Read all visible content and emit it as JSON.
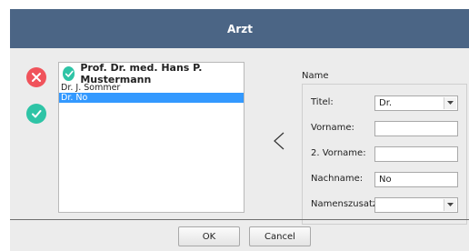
{
  "window": {
    "title": "Arzt"
  },
  "actions": {
    "delete_icon": "close-circle-icon",
    "confirm_icon": "check-circle-icon"
  },
  "list": {
    "header_icon": "check-circle-icon",
    "header": "Prof. Dr. med. Hans P. Mustermann",
    "items": [
      {
        "label": "Dr. J. Sommer",
        "selected": false
      },
      {
        "label": "Dr. No",
        "selected": true
      }
    ]
  },
  "transfer": {
    "glyph": "<"
  },
  "name_form": {
    "group_title": "Name",
    "titel_label": "Titel:",
    "titel_value": "Dr.",
    "vorname_label": "Vorname:",
    "vorname_value": "",
    "vorname2_label": "2. Vorname:",
    "vorname2_value": "",
    "nachname_label": "Nachname:",
    "nachname_value": "No",
    "zusatz_label": "Namenszusatz:",
    "zusatz_value": ""
  },
  "buttons": {
    "ok": "OK",
    "cancel": "Cancel"
  },
  "colors": {
    "titlebar": "#4b6585",
    "delete": "#f0535b",
    "confirm": "#2ec4a6",
    "selection": "#3399ff"
  }
}
